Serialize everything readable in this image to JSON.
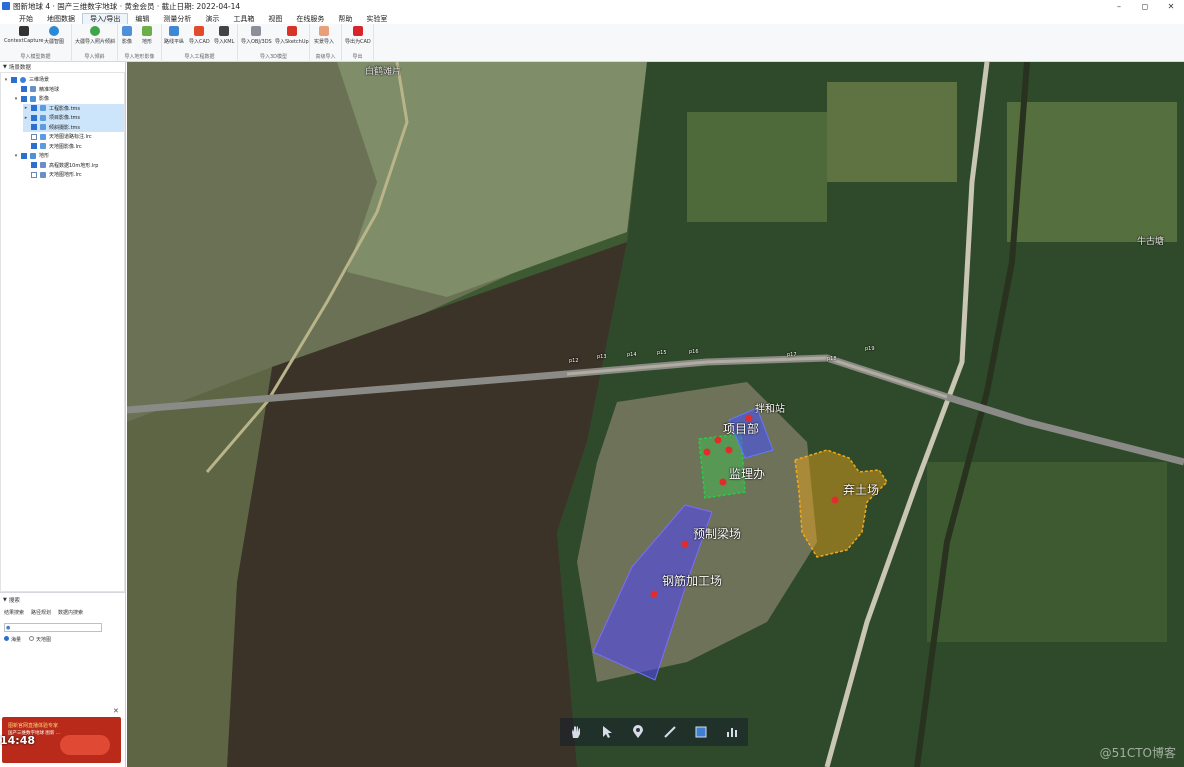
{
  "window": {
    "title": "图新地球 4 · 国产三维数字地球 · 黄金会员 · 截止日期: 2022-04-14",
    "buttons": [
      "–",
      "◻",
      "✕"
    ]
  },
  "menu": {
    "items": [
      "开始",
      "地图数据",
      "导入/导出",
      "编辑",
      "测量分析",
      "演示",
      "工具箱",
      "视图",
      "在线服务",
      "帮助",
      "实验室"
    ],
    "active_index": 2
  },
  "ribbon": {
    "groups": [
      {
        "label": "导入模型数据",
        "buttons": [
          "ContextCapture",
          "大疆智图"
        ]
      },
      {
        "label": "导入倾斜",
        "buttons": [
          "大疆导入照片倾斜"
        ]
      },
      {
        "label": "导入地形影像",
        "buttons": [
          "影像",
          "地形"
        ]
      },
      {
        "label": "导入工程数据",
        "buttons": [
          "路线平纵",
          "导入CAD",
          "导入KML"
        ]
      },
      {
        "label": "导入3D模型",
        "buttons": [
          "导入OBJ/3DS",
          "导入SketchUp"
        ]
      },
      {
        "label": "高级导入",
        "buttons": [
          "实景导入"
        ]
      },
      {
        "label": "导出",
        "buttons": [
          "导出为CAD"
        ]
      }
    ]
  },
  "left_panel": {
    "header": "场景数据",
    "tree": [
      {
        "label": "三维场景",
        "level": 0,
        "expanded": true,
        "checked": true,
        "selected": false
      },
      {
        "label": "精准地球",
        "level": 1,
        "expanded": false,
        "checked": true,
        "selected": false
      },
      {
        "label": "影像",
        "level": 1,
        "expanded": true,
        "checked": true,
        "selected": false
      },
      {
        "label": "工程影像.tms",
        "level": 2,
        "expanded": false,
        "checked": true,
        "selected": true
      },
      {
        "label": "项目影像.tms",
        "level": 2,
        "expanded": false,
        "checked": true,
        "selected": true
      },
      {
        "label": "倾斜摄影.tms",
        "level": 2,
        "expanded": false,
        "checked": true,
        "selected": true
      },
      {
        "label": "天地图道路标注.lrc",
        "level": 2,
        "expanded": false,
        "checked": false,
        "selected": false
      },
      {
        "label": "天地图影像.lrc",
        "level": 2,
        "expanded": false,
        "checked": true,
        "selected": false
      },
      {
        "label": "地形",
        "level": 1,
        "expanded": true,
        "checked": true,
        "selected": false
      },
      {
        "label": "高程数据10m地形.lrp",
        "level": 2,
        "expanded": false,
        "checked": true,
        "selected": false
      },
      {
        "label": "天地图地形.lrc",
        "level": 2,
        "expanded": false,
        "checked": false,
        "selected": false
      }
    ],
    "search": {
      "header": "搜索",
      "tabs": [
        "结果搜索",
        "路径规划",
        "数据内搜索"
      ],
      "placeholder": "",
      "radios": [
        {
          "label": "海量",
          "on": true
        },
        {
          "label": "天地图",
          "on": false
        }
      ]
    },
    "ad": {
      "line1": "图新官网直播体验专家",
      "line2": "国产三维数字地球 图新 ...",
      "clock": "14:48",
      "close": "✕"
    }
  },
  "map": {
    "labels": {
      "river": "白鹤滩片",
      "town": "牛古塘",
      "project_dept": "项目部",
      "mix_station": "拌和站",
      "supervision": "监理办",
      "spoil": "弃土场",
      "precast": "预制梁场",
      "rebar": "钢筋加工场"
    },
    "piers": [
      "p12",
      "p13",
      "p14",
      "p15",
      "p16",
      "p17",
      "p18",
      "p19"
    ],
    "tools": [
      "hand-icon",
      "pointer-icon",
      "pin-icon",
      "line-icon",
      "polygon-icon",
      "chart-icon"
    ],
    "watermark": "@51CTO博客"
  },
  "colors": {
    "water": "#3b3228",
    "project_blue": "#3b4dff",
    "green_zone": "#1f9e3b",
    "spoil_orange": "#f2a818",
    "pin_red": "#e22c2c"
  }
}
